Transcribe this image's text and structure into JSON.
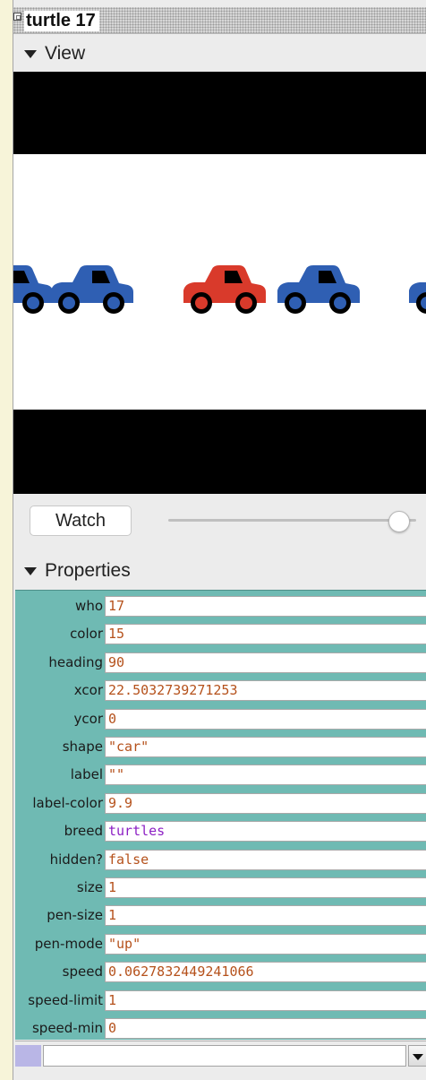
{
  "window": {
    "title": "turtle 17"
  },
  "view_section": {
    "header": "View"
  },
  "watch": {
    "button_label": "Watch",
    "speed_slider_fraction": 0.93
  },
  "cars": [
    {
      "color": "#2f5fb3"
    },
    {
      "color": "#2f5fb3"
    },
    {
      "color": "#d93a2b"
    },
    {
      "color": "#2f5fb3"
    },
    {
      "color": "#2f5fb3"
    }
  ],
  "properties_section": {
    "header": "Properties"
  },
  "properties": [
    {
      "label": "who",
      "value": "17"
    },
    {
      "label": "color",
      "value": "15"
    },
    {
      "label": "heading",
      "value": "90"
    },
    {
      "label": "xcor",
      "value": "22.5032739271253"
    },
    {
      "label": "ycor",
      "value": "0"
    },
    {
      "label": "shape",
      "value": "\"car\""
    },
    {
      "label": "label",
      "value": "\"\""
    },
    {
      "label": "label-color",
      "value": "9.9"
    },
    {
      "label": "breed",
      "value": "turtles"
    },
    {
      "label": "hidden?",
      "value": "false"
    },
    {
      "label": "size",
      "value": "1"
    },
    {
      "label": "pen-size",
      "value": "1"
    },
    {
      "label": "pen-mode",
      "value": "\"up\""
    },
    {
      "label": "speed",
      "value": "0.0627832449241066"
    },
    {
      "label": "speed-limit",
      "value": "1"
    },
    {
      "label": "speed-min",
      "value": "0"
    }
  ],
  "command": {
    "value": ""
  },
  "colors": {
    "properties_bg": "#6fbab3",
    "value_text": "#b5511b",
    "breed_text": "#8c1fc4",
    "road": "#000000"
  }
}
